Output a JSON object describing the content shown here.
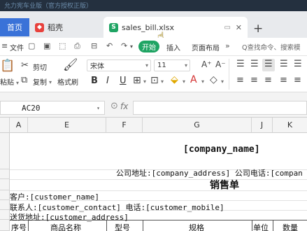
{
  "titlebar": {
    "text": "允力宪车业版（官方授权正版）"
  },
  "tabs": {
    "home": "首页",
    "docer": "稻壳",
    "file": "sales_bill.xlsx",
    "new_tab": "+"
  },
  "menu": {
    "file": "文件",
    "start": "开始",
    "insert": "插入",
    "page_layout": "页面布局",
    "search": "Q查找命令、搜索模"
  },
  "toolbar": {
    "paste": "粘贴",
    "cut": "剪切",
    "copy": "复制",
    "format_painter": "格式刷",
    "font_name": "宋体",
    "font_size": "11",
    "bold": "B",
    "italic": "I",
    "underline": "U"
  },
  "formula": {
    "cell_ref": "AC20",
    "fx": "fx",
    "content": ""
  },
  "columns": [
    "A",
    "E",
    "F",
    "G",
    "J",
    "K"
  ],
  "rows": {
    "company_name": "[company_name]",
    "company_info": "公司地址:[company_address] 公司电话:[compan",
    "title": "销售单",
    "customer": "客户:[customer_name]",
    "contact": "联系人:[customer_contact]  电话:[customer_mobile]",
    "shipping": "送货地址:[customer_address]",
    "header_cells": [
      "序号",
      "商品名称",
      "型号",
      "规格",
      "单位",
      "数量"
    ]
  }
}
